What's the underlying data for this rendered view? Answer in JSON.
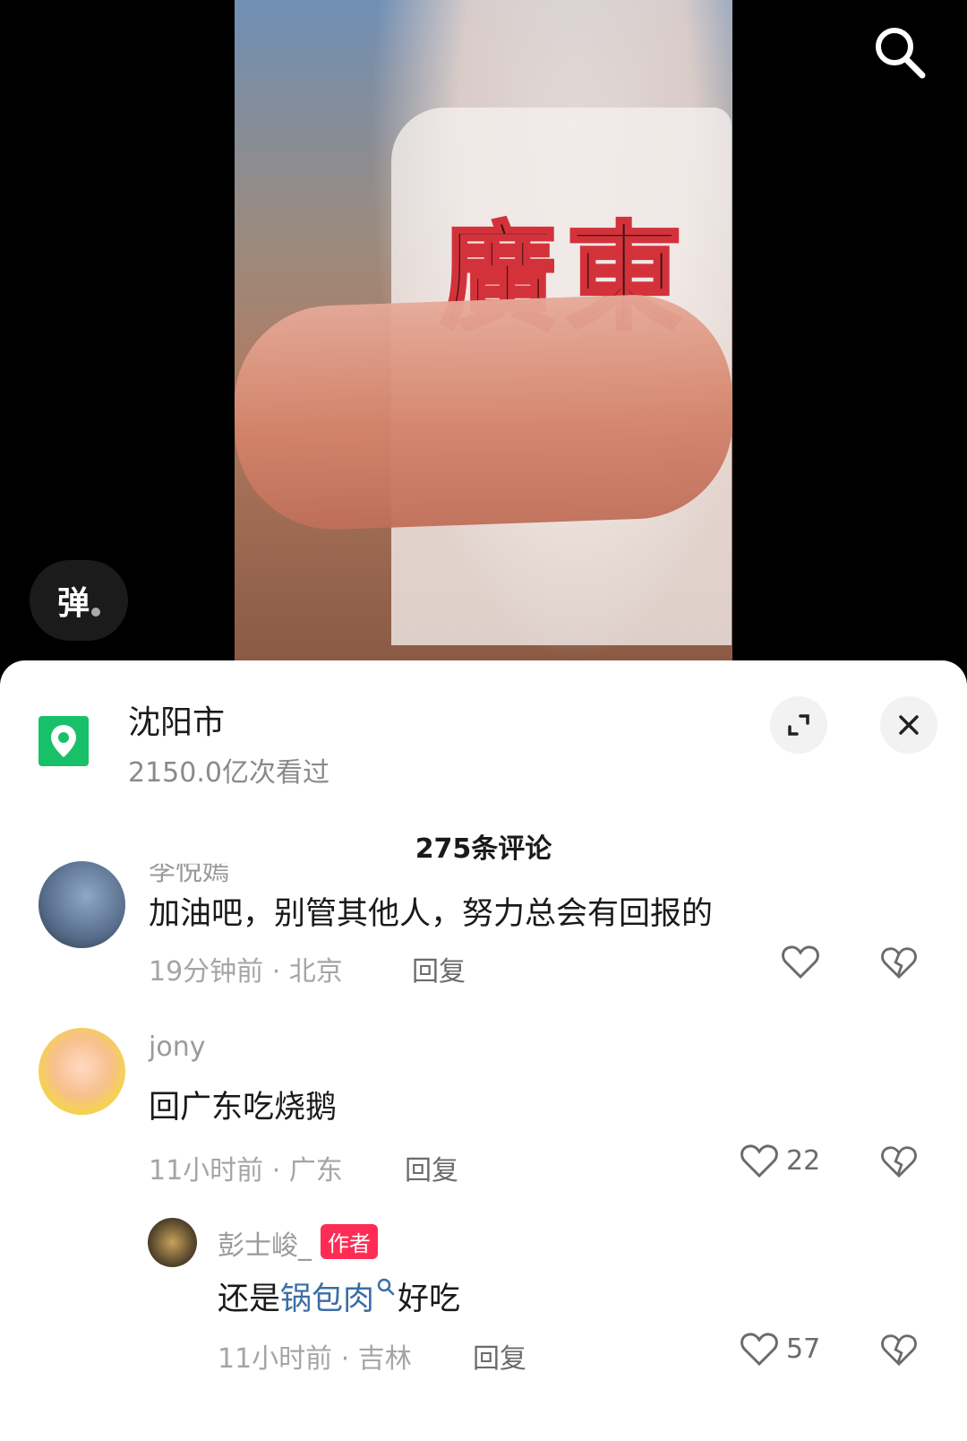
{
  "video": {
    "shirt_text": "廣東",
    "danmu_label": "弹"
  },
  "location": {
    "title": "沈阳市",
    "views": "2150.0亿次看过"
  },
  "comments_header": {
    "count": "275条评论"
  },
  "comments": [
    {
      "username": "李悦嫣",
      "text": "加油吧，别管其他人，努力总会有回报的",
      "time_loc": "19分钟前 · 北京",
      "reply_label": "回复",
      "likes": ""
    },
    {
      "username": "jony",
      "text": "回广东吃烧鹅",
      "time_loc": "11小时前 · 广东",
      "reply_label": "回复",
      "likes": "22"
    }
  ],
  "reply": {
    "username": "彭士峻_",
    "badge": "作者",
    "text_prefix": "还是",
    "text_link": "锅包肉",
    "text_suffix": "好吃",
    "time_loc": "11小时前 · 吉林",
    "reply_label": "回复",
    "likes": "57"
  },
  "colors": {
    "accent_green": "#19c06a",
    "badge_red": "#fe2c55",
    "link_blue": "#3a6ea5"
  }
}
